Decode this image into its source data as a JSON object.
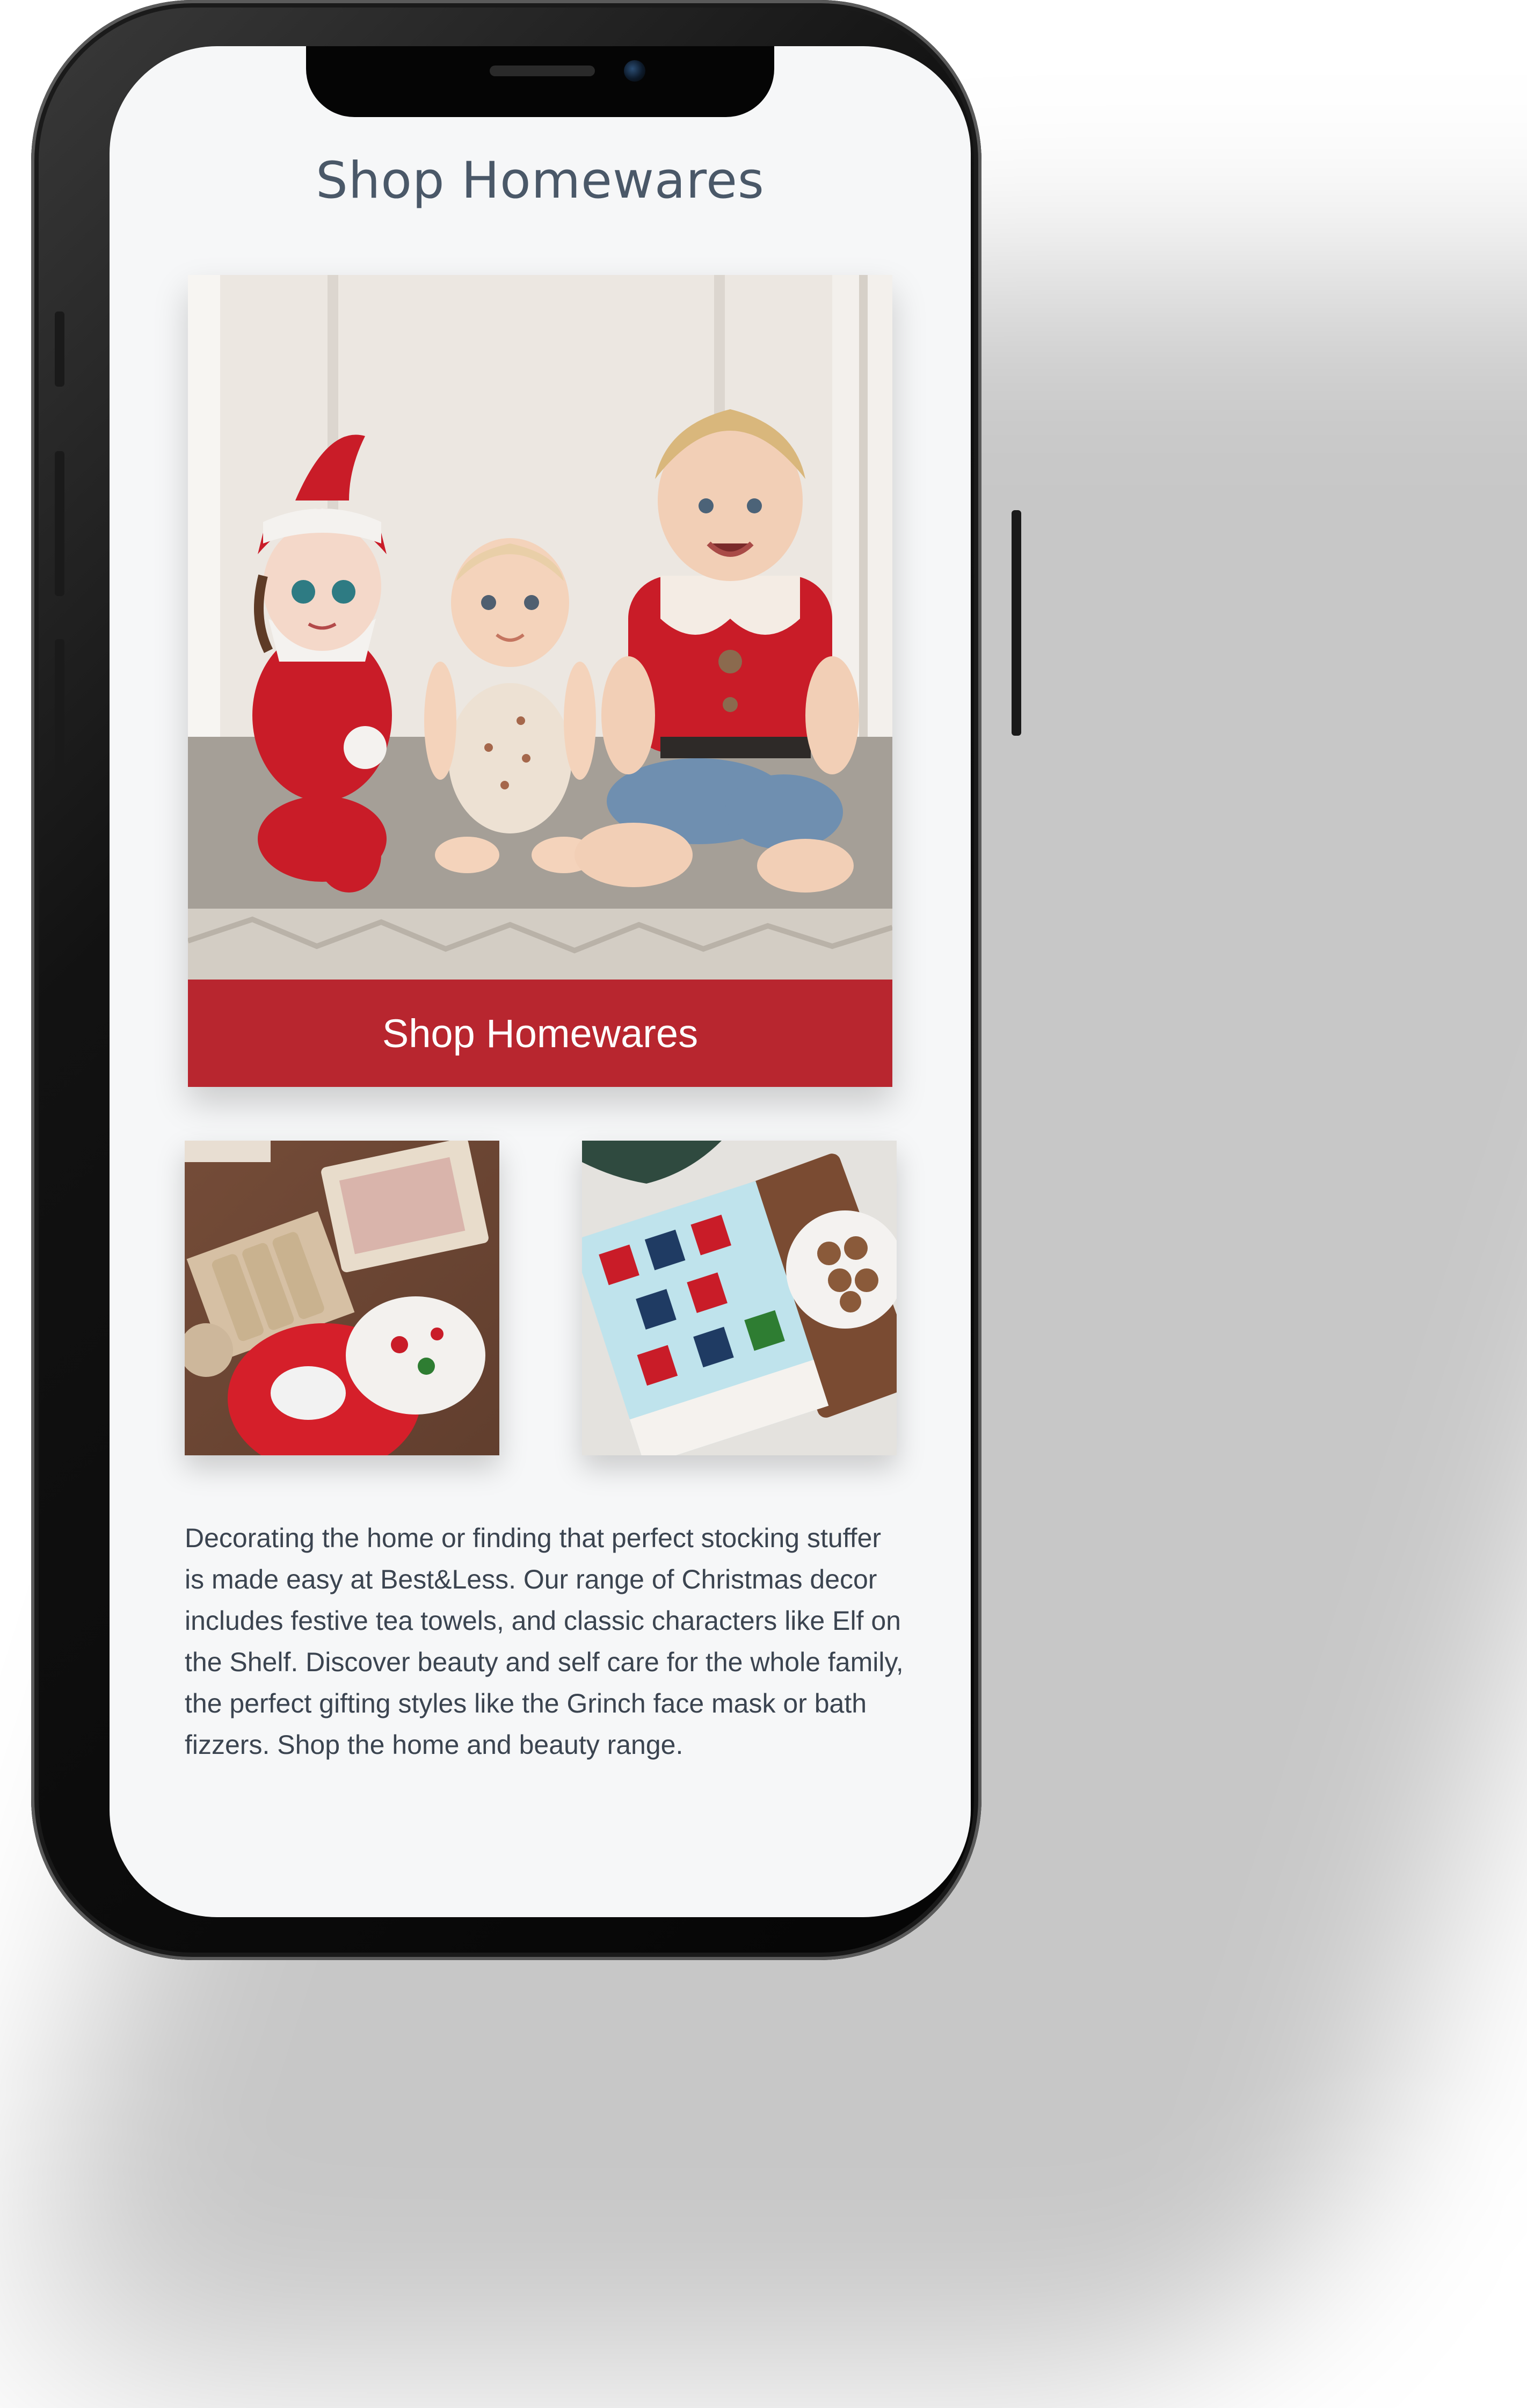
{
  "page": {
    "title": "Shop Homewares"
  },
  "hero": {
    "cta_label": "Shop Homewares",
    "cta_color": "#b8262f"
  },
  "body_text": "Decorating the home or finding that perfect stocking stuffer is made easy at Best&Less. Our range of Christmas decor includes festive tea towels, and classic characters like Elf on the Shelf. Discover beauty and self care for the whole family, the perfect gifting styles like the Grinch face mask or bath fizzers. Shop the home and beauty range.",
  "icons": {
    "camera": "front-camera-icon",
    "speaker": "earpiece-speaker-icon"
  }
}
